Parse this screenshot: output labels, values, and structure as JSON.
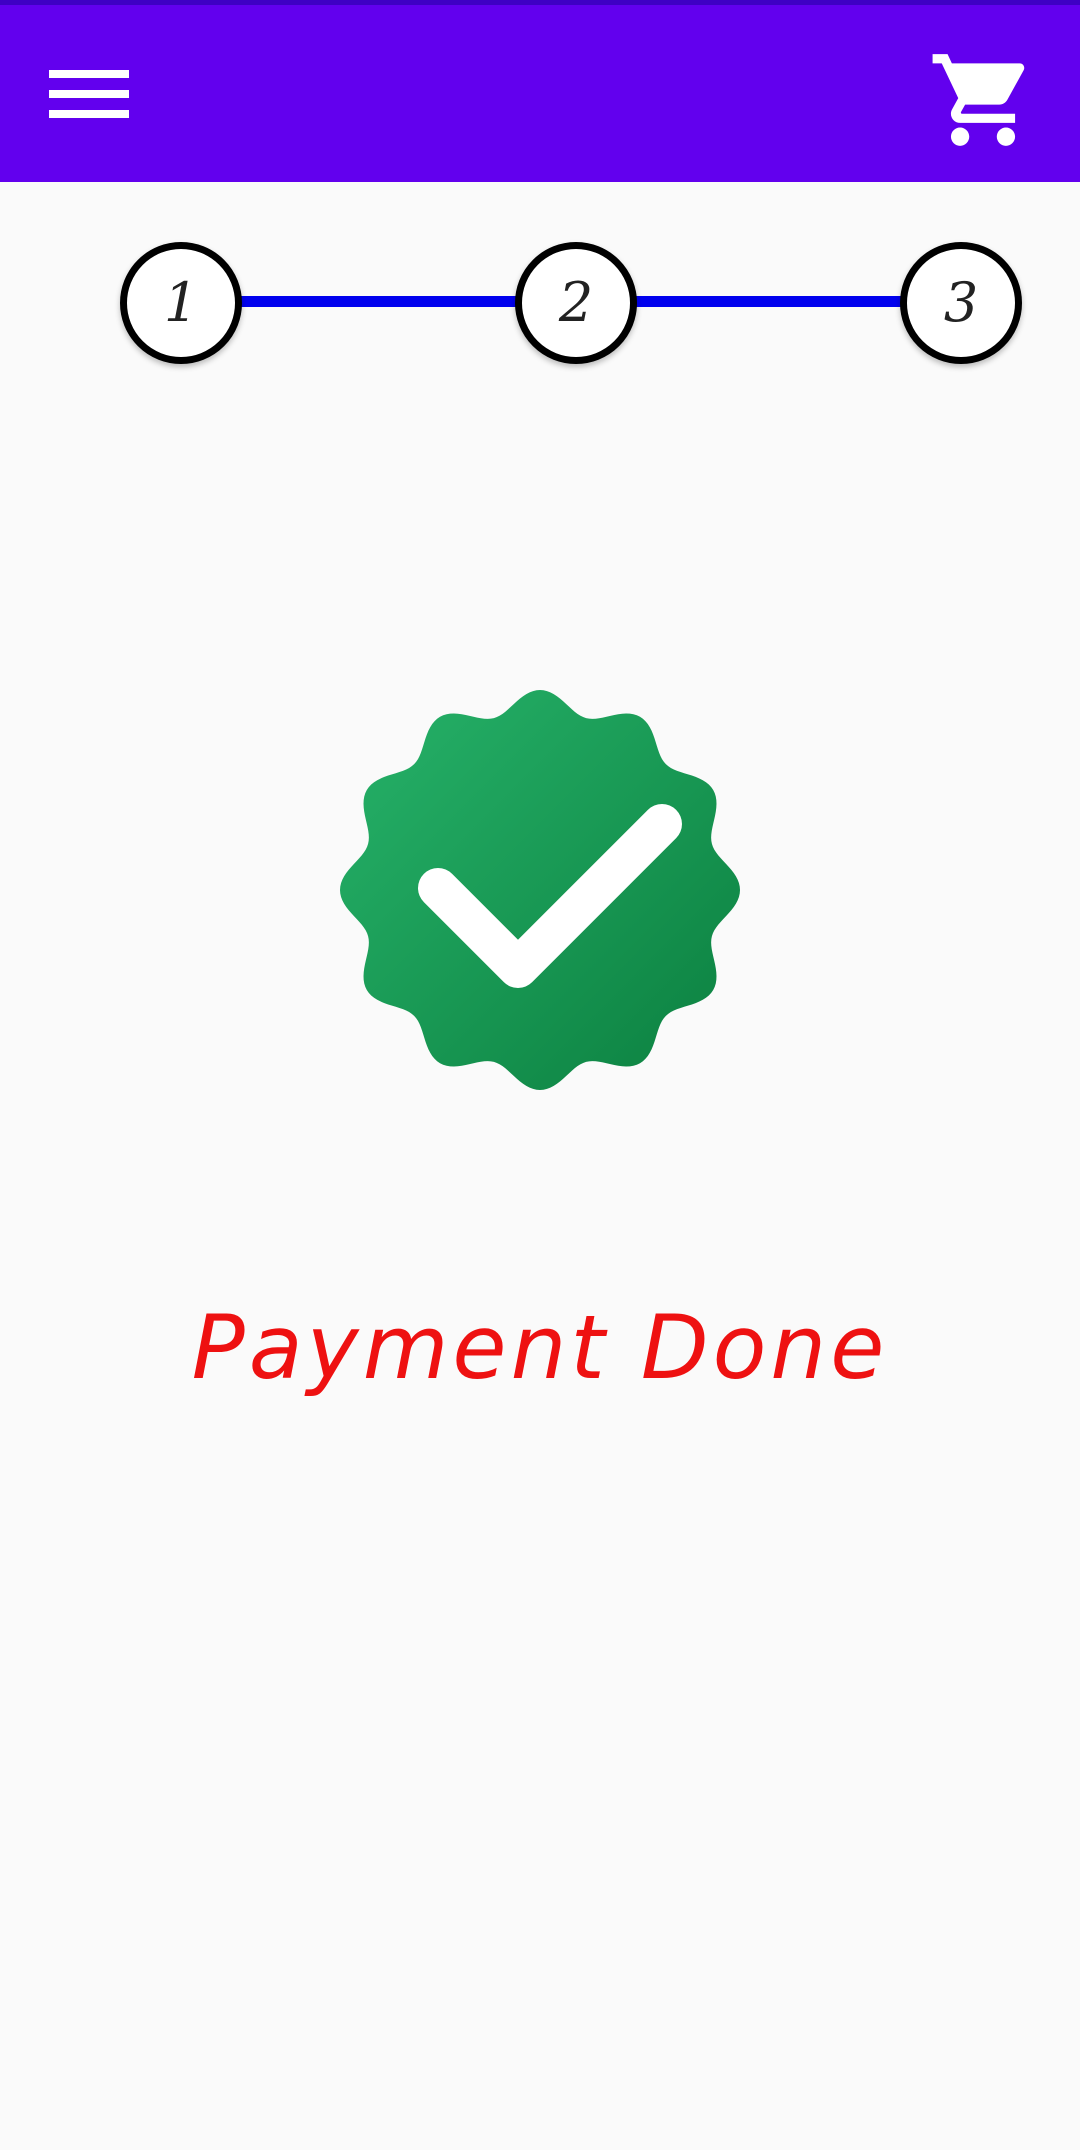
{
  "app_bar": {
    "menu_icon": "hamburger-menu-icon",
    "cart_icon": "shopping-cart-icon",
    "background_color": "#6200ee"
  },
  "stepper": {
    "steps": [
      {
        "label": "1"
      },
      {
        "label": "2"
      },
      {
        "label": "3"
      }
    ],
    "line_color": "#0000ee"
  },
  "status": {
    "icon": "verified-check-badge-icon",
    "icon_color": "#1a9e55",
    "message": "Payment Done",
    "message_color": "#ee1111"
  }
}
